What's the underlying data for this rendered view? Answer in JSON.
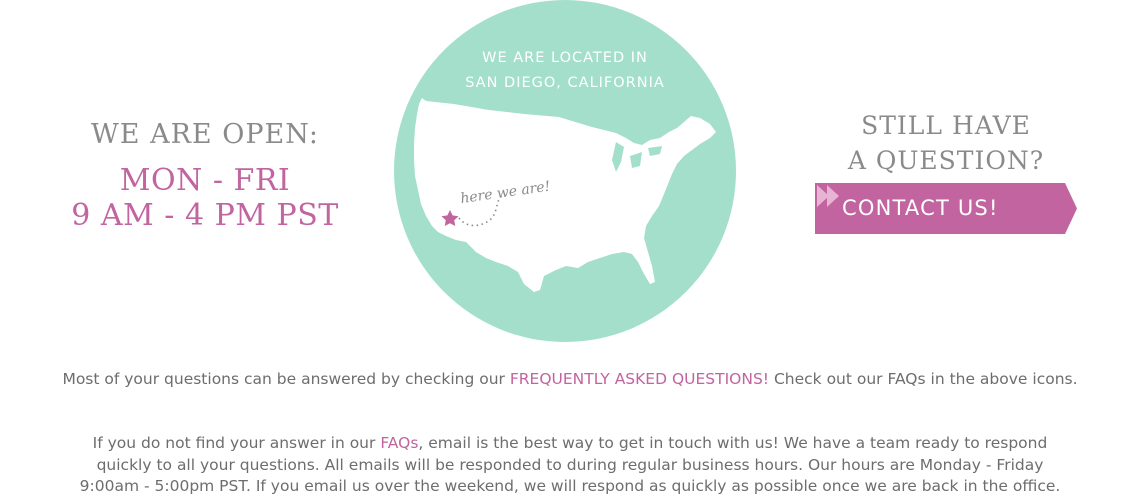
{
  "hours": {
    "heading": "WE ARE OPEN:",
    "days": "MON - FRI",
    "time": "9 AM - 4 PM PST"
  },
  "location": {
    "caption_line1": "WE ARE LOCATED IN",
    "caption_line2": "SAN DIEGO, CALIFORNIA",
    "marker_text": "here we are!",
    "circle_color": "#a3dfcb",
    "marker_color": "#c1649f"
  },
  "question": {
    "line1": "STILL HAVE",
    "line2": "A QUESTION?",
    "button_label": "CONTACT US!",
    "button_color": "#c1649f"
  },
  "faq_line": {
    "before": "Most of your questions can be answered by checking our ",
    "link": "FREQUENTLY ASKED QUESTIONS!",
    "after": " Check out our FAQs in the above icons."
  },
  "email_paragraph": {
    "line1_before": "If you do not find your answer in our ",
    "line1_link": "FAQs",
    "line1_after": ", email is the best way to get in touch with us! We have a team ready to respond",
    "line2": "quickly to all your questions. All emails will be responded to during regular business hours. Our hours are Monday - Friday",
    "line3": "9:00am - 5:00pm PST. If you email us over the weekend, we will respond as quickly as possible once we are back in the office."
  },
  "colors": {
    "accent": "#c1649f",
    "heading_gray": "#8a8a8a",
    "body_text": "#6d6d6d",
    "map_circle": "#a3dfcb"
  }
}
